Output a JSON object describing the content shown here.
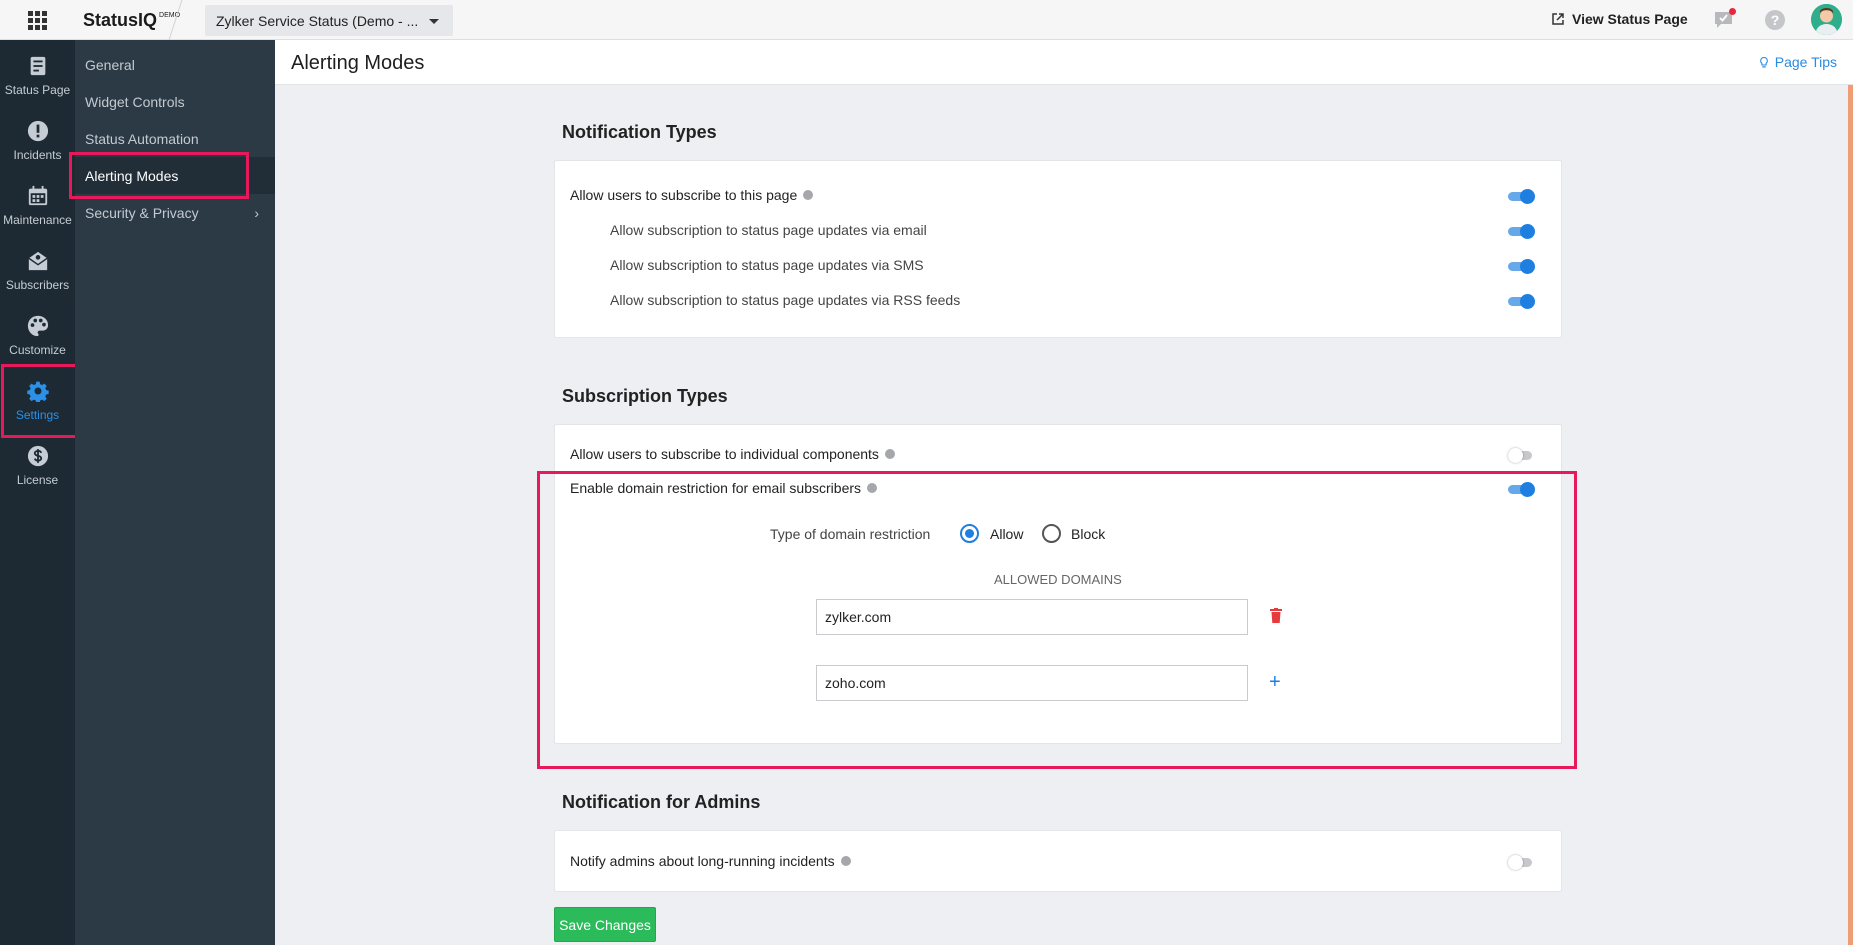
{
  "app": {
    "brand": "StatusIQ",
    "brand_badge": "DEMO",
    "page_selector": "Zylker Service Status (Demo - ...",
    "view_status_page": "View Status Page",
    "help": "?"
  },
  "rail": [
    {
      "label": "Status Page",
      "icon": "status-page-icon"
    },
    {
      "label": "Incidents",
      "icon": "incident-icon"
    },
    {
      "label": "Maintenance",
      "icon": "calendar-icon"
    },
    {
      "label": "Subscribers",
      "icon": "subscribers-icon"
    },
    {
      "label": "Customize",
      "icon": "palette-icon"
    },
    {
      "label": "Settings",
      "icon": "gear-icon",
      "active": true
    },
    {
      "label": "License",
      "icon": "dollar-icon"
    }
  ],
  "submenu": [
    {
      "label": "General"
    },
    {
      "label": "Widget Controls"
    },
    {
      "label": "Status Automation"
    },
    {
      "label": "Alerting Modes",
      "active": true
    },
    {
      "label": "Security & Privacy",
      "has_children": true
    }
  ],
  "header": {
    "title": "Alerting Modes",
    "page_tips": "Page Tips"
  },
  "notification_types": {
    "title": "Notification Types",
    "main": {
      "label": "Allow users to subscribe to this page",
      "enabled": true
    },
    "options": [
      {
        "label": "Allow subscription to status page updates via email",
        "enabled": true
      },
      {
        "label": "Allow subscription to status page updates via SMS",
        "enabled": true
      },
      {
        "label": "Allow subscription to status page updates via RSS feeds",
        "enabled": true
      }
    ]
  },
  "subscription_types": {
    "title": "Subscription Types",
    "components": {
      "label": "Allow users to subscribe to individual components",
      "enabled": false
    },
    "domain_restriction": {
      "label": "Enable domain restriction for email subscribers",
      "enabled": true
    },
    "restriction_type_label": "Type of domain restriction",
    "restriction_options": [
      {
        "label": "Allow",
        "selected": true
      },
      {
        "label": "Block",
        "selected": false
      }
    ],
    "allowed_domains_heading": "ALLOWED DOMAINS",
    "domains": [
      "zylker.com",
      "zoho.com"
    ]
  },
  "admin_notifications": {
    "title": "Notification for Admins",
    "long_running": {
      "label": "Notify admins about long-running incidents",
      "enabled": false
    }
  },
  "save_button": "Save Changes",
  "colors": {
    "accent": "#1f7fe0",
    "highlight": "#e8195a",
    "save": "#2bbb5a",
    "delete": "#e53b3b"
  }
}
